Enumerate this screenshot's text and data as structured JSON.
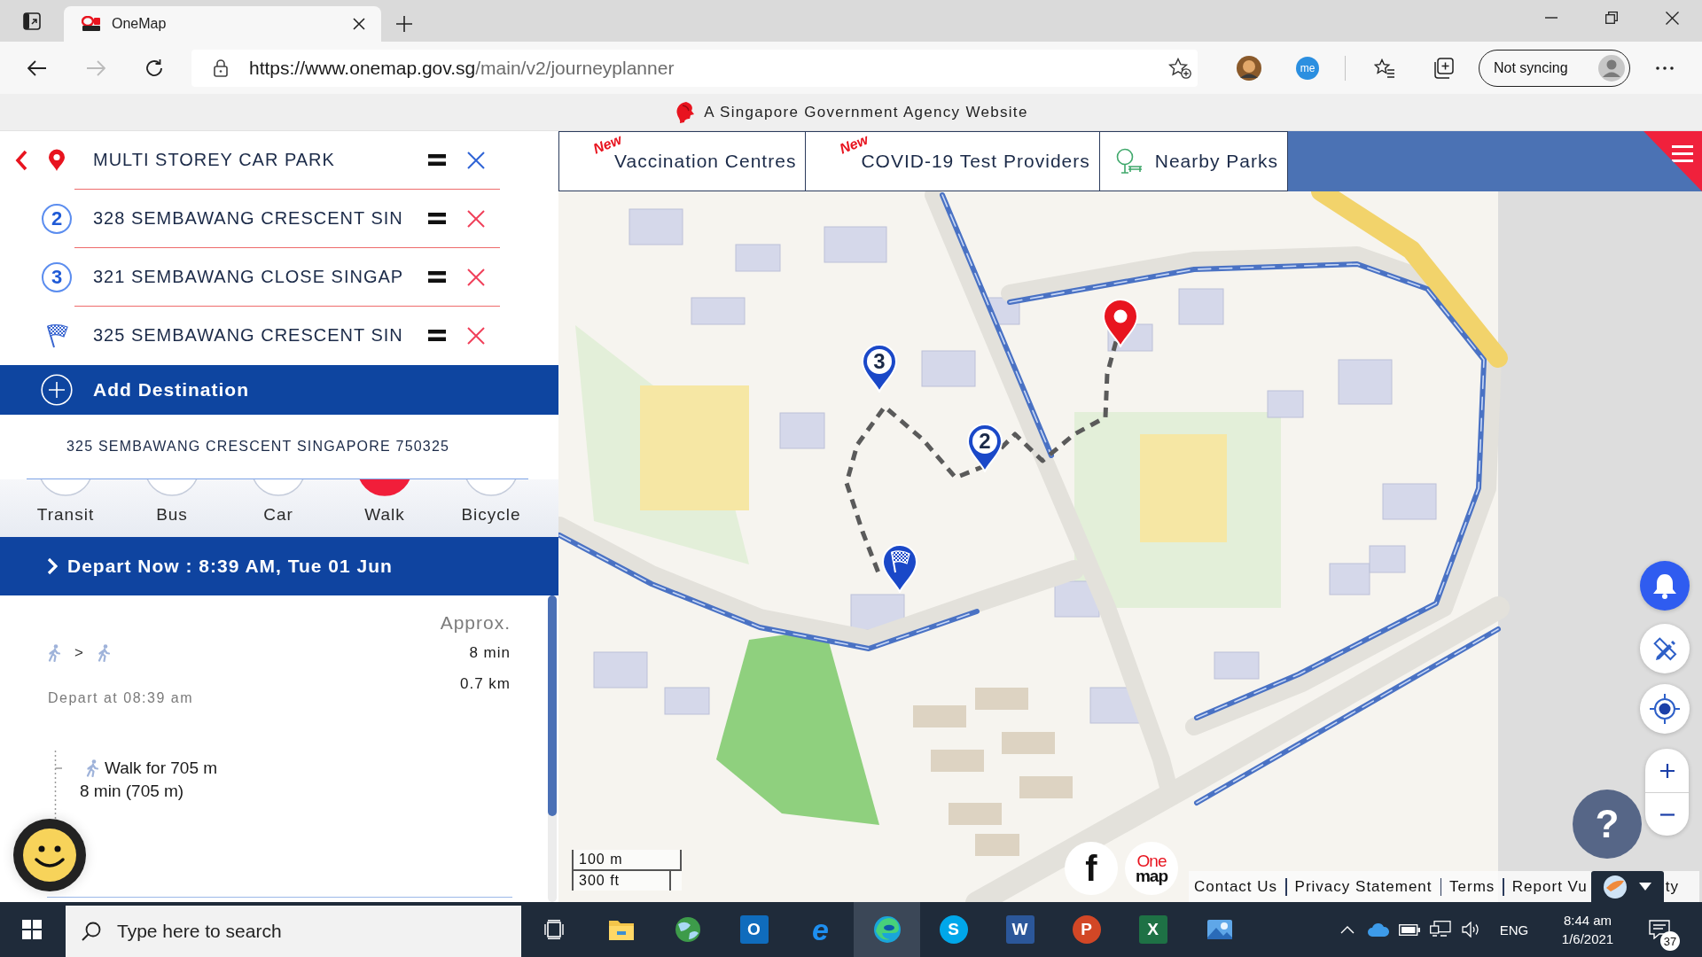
{
  "browser": {
    "tabs": [
      {
        "title": "OneMap",
        "selected": true
      }
    ],
    "nav": [
      {
        "kind": "back",
        "disabled": false
      },
      {
        "kind": "forward",
        "disabled": true
      },
      {
        "kind": "refresh",
        "disabled": false
      }
    ],
    "url": {
      "host": "https://www.onemap.gov.sg",
      "path": "/main/v2/journeyplanner"
    },
    "extension_badge": "me",
    "sync_button": "Not syncing"
  },
  "gov_banner": "A Singapore Government Agency Website",
  "planner": {
    "stops": [
      {
        "kind": "origin",
        "value": "MULTI STOREY CAR PARK"
      },
      {
        "kind": "stop",
        "number": "2",
        "value": "328 SEMBAWANG CRESCENT SIN"
      },
      {
        "kind": "stop",
        "number": "3",
        "value": "321 SEMBAWANG CLOSE SINGAP"
      },
      {
        "kind": "destination",
        "value": "325 SEMBAWANG CRESCENT SIN"
      }
    ],
    "add_button": "Add Destination",
    "selected_address": "325 SEMBAWANG CRESCENT SINGAPORE 750325",
    "modes": [
      {
        "label": "Transit",
        "selected": false
      },
      {
        "label": "Bus",
        "selected": false
      },
      {
        "label": "Car",
        "selected": false
      },
      {
        "label": "Walk",
        "selected": true
      },
      {
        "label": "Bicycle",
        "selected": false
      }
    ],
    "depart_bar": "Depart Now : 8:39 AM, Tue 01 Jun",
    "result": {
      "segments": [
        {
          "kind": "walk"
        },
        {
          "kind": "walk"
        }
      ],
      "separator": ">",
      "approx": "Approx.",
      "duration": "8 min",
      "distance": "0.7 km",
      "depart_at": "Depart at 08:39 am",
      "legs": [
        {
          "kind": "walk",
          "title": "Walk for 705 m",
          "detail": "8 min (705 m)"
        }
      ]
    }
  },
  "map": {
    "category_tabs": [
      {
        "kind": "new",
        "badge": "New",
        "label": "Vaccination Centres"
      },
      {
        "kind": "new",
        "badge": "New",
        "label": "COVID-19 Test Providers"
      },
      {
        "kind": "park",
        "label": "Nearby Parks"
      }
    ],
    "markers": [
      {
        "kind": "origin"
      },
      {
        "kind": "stop",
        "number": "3"
      },
      {
        "kind": "stop",
        "number": "2"
      },
      {
        "kind": "destination"
      }
    ],
    "scale": [
      "100 m",
      "300 ft"
    ],
    "help_button": "?",
    "footer": {
      "social_button": "f",
      "logo": [
        "One",
        "map"
      ],
      "links": [
        "Contact Us",
        "Privacy Statement",
        "Terms",
        "Report Vu"
      ],
      "link_tail": "ty"
    }
  },
  "taskbar": {
    "search_placeholder": "Type here to search",
    "apps": [
      {
        "kind": "task-view",
        "selected": false
      },
      {
        "kind": "folder",
        "selected": false
      },
      {
        "kind": "globe",
        "selected": false
      },
      {
        "kind": "tile",
        "glyph": "O",
        "color": "#0f6cbd",
        "selected": false
      },
      {
        "kind": "letter",
        "glyph": "e",
        "color": "#1e8ff0",
        "selected": false
      },
      {
        "kind": "swirl",
        "selected": true
      },
      {
        "kind": "disc",
        "glyph": "S",
        "color": "#00a7ea",
        "selected": false
      },
      {
        "kind": "tile",
        "glyph": "W",
        "color": "#2b579a",
        "selected": false
      },
      {
        "kind": "disc",
        "glyph": "P",
        "color": "#d24726",
        "selected": false
      },
      {
        "kind": "tile",
        "glyph": "X",
        "color": "#1e7145",
        "selected": false
      },
      {
        "kind": "picture",
        "selected": false
      }
    ],
    "tray": {
      "language": "ENG",
      "time": "8:44 am",
      "date": "1/6/2021",
      "notification_count": "37"
    }
  }
}
